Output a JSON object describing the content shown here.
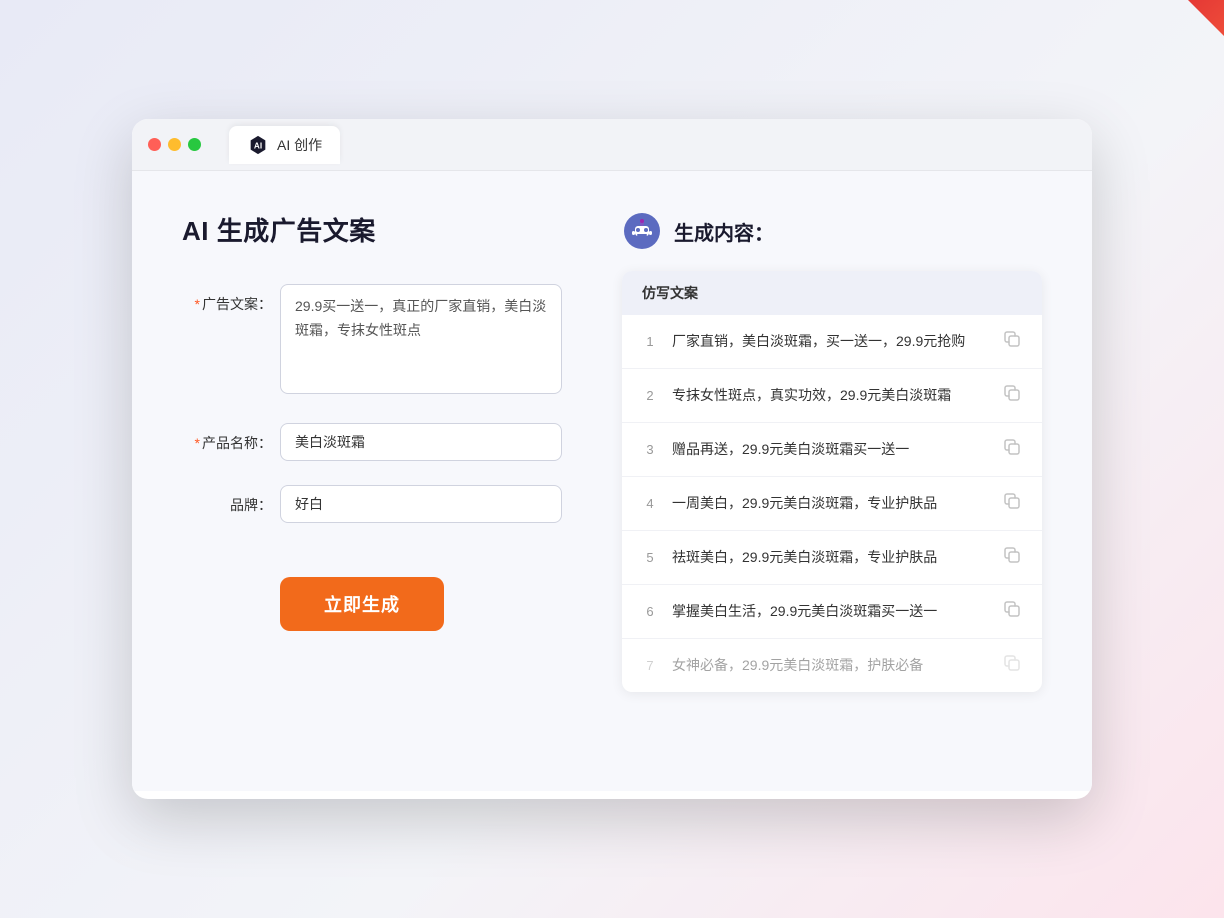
{
  "window": {
    "tab_label": "AI 创作"
  },
  "page": {
    "title": "AI 生成广告文案"
  },
  "form": {
    "ad_copy_label": "广告文案：",
    "ad_copy_required": "＊",
    "ad_copy_value": "29.9买一送一，真正的厂家直销，美白淡斑霜，专抹女性斑点",
    "product_label": "产品名称：",
    "product_required": "＊",
    "product_value": "美白淡斑霜",
    "brand_label": "品牌：",
    "brand_value": "好白",
    "generate_btn": "立即生成"
  },
  "result": {
    "header_title": "生成内容：",
    "column_label": "仿写文案",
    "items": [
      {
        "num": "1",
        "text": "厂家直销，美白淡斑霜，买一送一，29.9元抢购",
        "dimmed": false
      },
      {
        "num": "2",
        "text": "专抹女性斑点，真实功效，29.9元美白淡斑霜",
        "dimmed": false
      },
      {
        "num": "3",
        "text": "赠品再送，29.9元美白淡斑霜买一送一",
        "dimmed": false
      },
      {
        "num": "4",
        "text": "一周美白，29.9元美白淡斑霜，专业护肤品",
        "dimmed": false
      },
      {
        "num": "5",
        "text": "祛斑美白，29.9元美白淡斑霜，专业护肤品",
        "dimmed": false
      },
      {
        "num": "6",
        "text": "掌握美白生活，29.9元美白淡斑霜买一送一",
        "dimmed": false
      },
      {
        "num": "7",
        "text": "女神必备，29.9元美白淡斑霜，护肤必备",
        "dimmed": true
      }
    ]
  },
  "colors": {
    "accent_orange": "#f26a1b",
    "required_red": "#ff5722",
    "brand_purple": "#7c83fd"
  }
}
